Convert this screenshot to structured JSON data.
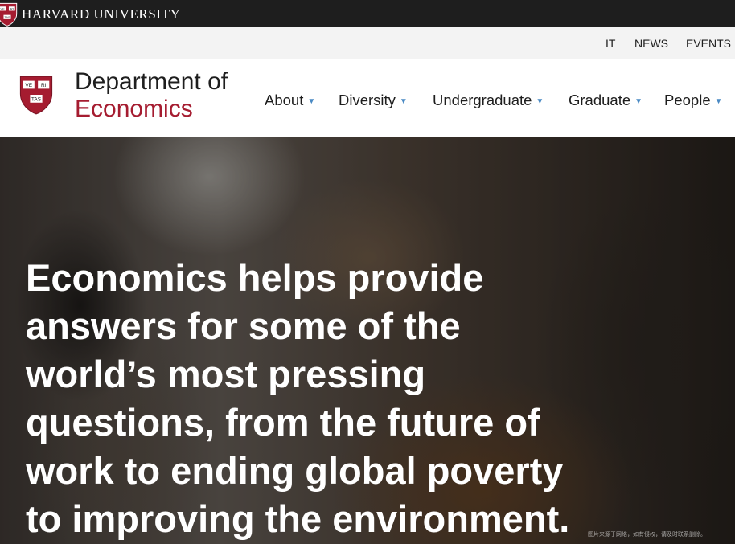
{
  "university_bar": {
    "name": "HARVARD UNIVERSITY",
    "shield_icon": "harvard-veritas-shield",
    "shield_text": [
      "VE",
      "RI",
      "TAS"
    ],
    "background": "#1e1e1e"
  },
  "utility_nav": {
    "links": [
      "IT",
      "NEWS",
      "EVENTS"
    ],
    "background": "#f3f3f3"
  },
  "header": {
    "logo_icon": "harvard-veritas-shield",
    "logo_text": [
      "VE",
      "RI",
      "TAS"
    ],
    "title_line1": "Department of",
    "title_line2": "Economics",
    "accent_color": "#a51c30",
    "nav": [
      {
        "label": "About",
        "icon": "caret-down-icon"
      },
      {
        "label": "Diversity",
        "icon": "caret-down-icon"
      },
      {
        "label": "Undergraduate",
        "icon": "caret-down-icon"
      },
      {
        "label": "Graduate",
        "icon": "caret-down-icon"
      },
      {
        "label": "People",
        "icon": "caret-down-icon"
      }
    ],
    "caret_color": "#4a8ac4"
  },
  "hero": {
    "lines": [
      "Economics helps provide",
      "answers for some of the",
      "world’s most pressing",
      "questions, from the future of",
      "work to ending global poverty",
      "to improving the environment."
    ],
    "image_credit": "图片来源于网络，如有侵权，请及时联系删除。"
  }
}
